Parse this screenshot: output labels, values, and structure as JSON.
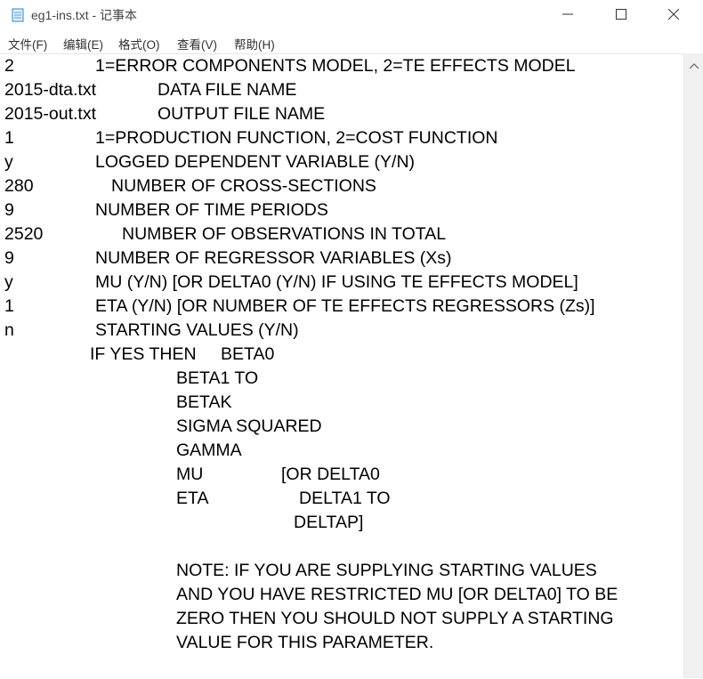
{
  "window": {
    "title": "eg1-ins.txt - 记事本"
  },
  "menu": [
    "文件(F)",
    "编辑(E)",
    "格式(O)",
    "查看(V)",
    "帮助(H)"
  ],
  "lines": [
    [
      "2",
      "1=ERROR COMPONENTS MODEL, 2=TE EFFECTS MODEL"
    ],
    [
      "2015-dta.txt",
      "DATA FILE NAME"
    ],
    [
      "2015-out.txt",
      "OUTPUT FILE NAME"
    ],
    [
      "1",
      "1=PRODUCTION FUNCTION, 2=COST FUNCTION"
    ],
    [
      "y",
      "LOGGED DEPENDENT VARIABLE (Y/N)"
    ],
    [
      "280",
      "NUMBER OF CROSS-SECTIONS"
    ],
    [
      "9",
      "NUMBER OF TIME PERIODS"
    ],
    [
      "2520",
      "NUMBER OF OBSERVATIONS IN TOTAL"
    ],
    [
      "9",
      "NUMBER OF REGRESSOR VARIABLES (Xs)"
    ],
    [
      "y",
      "MU (Y/N) [OR DELTA0 (Y/N) IF USING TE EFFECTS MODEL]"
    ],
    [
      "1",
      "ETA (Y/N) [OR NUMBER OF TE EFFECTS REGRESSORS (Zs)]"
    ],
    [
      "n",
      "STARTING VALUES (Y/N)"
    ],
    [
      "IF YES THEN",
      "BETA0"
    ],
    [
      "BETA1 TO"
    ],
    [
      "BETAK"
    ],
    [
      "SIGMA SQUARED"
    ],
    [
      "GAMMA"
    ],
    [
      "MU",
      "[OR DELTA0"
    ],
    [
      "ETA",
      "DELTA1 TO"
    ],
    [
      "DELTAP]"
    ],
    [],
    [
      "NOTE: IF YOU ARE SUPPLYING STARTING VALUES"
    ],
    [
      "AND YOU HAVE RESTRICTED MU [OR DELTA0] TO BE"
    ],
    [
      "ZERO THEN YOU SHOULD NOT SUPPLY A STARTING"
    ],
    [
      "VALUE FOR THIS PARAMETER."
    ]
  ]
}
